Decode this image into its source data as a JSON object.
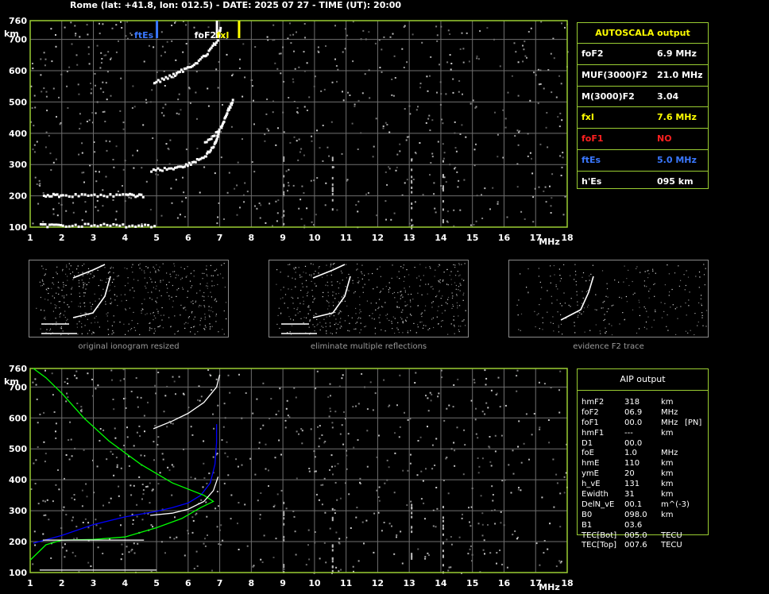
{
  "header": "Rome (lat: +41.8, lon: 012.5) - DATE: 2025 07 27 - TIME (UT): 20:00",
  "chart_data": [
    {
      "type": "scatter",
      "title": "",
      "xlabel": "MHz",
      "ylabel": "km",
      "xlim": [
        1,
        18
      ],
      "ylim": [
        100,
        760
      ],
      "x_ticks": [
        "1",
        "2",
        "3",
        "4",
        "5",
        "6",
        "7",
        "8",
        "9",
        "10",
        "11",
        "12",
        "13",
        "14",
        "15",
        "16",
        "17",
        "18"
      ],
      "y_ticks": [
        "100",
        "200",
        "300",
        "400",
        "500",
        "600",
        "700",
        "760"
      ],
      "grid": true,
      "markers": [
        {
          "label": "ftEs",
          "x": 5.0,
          "color": "#3a78ff"
        },
        {
          "label": "foF2",
          "x": 6.9,
          "color": "#ffffff"
        },
        {
          "label": "fxI",
          "x": 7.6,
          "color": "#ffff00"
        }
      ],
      "series": [
        {
          "values": [
            [
              1.3,
              108
            ],
            [
              2,
              110
            ],
            [
              3,
              110
            ],
            [
              4,
              108
            ],
            [
              5,
              108
            ]
          ]
        },
        {
          "values": [
            [
              1.4,
              205
            ],
            [
              2,
              205
            ],
            [
              3,
              206
            ],
            [
              4,
              205
            ],
            [
              4.6,
              204
            ]
          ]
        },
        {
          "values": [
            [
              4.8,
              285
            ],
            [
              5.5,
              292
            ],
            [
              6.0,
              305
            ],
            [
              6.5,
              330
            ],
            [
              6.8,
              365
            ],
            [
              6.95,
              410
            ]
          ]
        },
        {
          "values": [
            [
              6.5,
              370
            ],
            [
              7.0,
              420
            ],
            [
              7.2,
              470
            ],
            [
              7.4,
              510
            ]
          ]
        },
        {
          "values": [
            [
              4.9,
              565
            ],
            [
              5.5,
              590
            ],
            [
              6.0,
              615
            ],
            [
              6.5,
              650
            ],
            [
              6.9,
              700
            ],
            [
              7.0,
              740
            ]
          ]
        }
      ]
    },
    {
      "type": "line",
      "title": "",
      "xlabel": "MHz",
      "ylabel": "km",
      "xlim": [
        1,
        18
      ],
      "ylim": [
        100,
        760
      ],
      "x_ticks": [
        "1",
        "2",
        "3",
        "4",
        "5",
        "6",
        "7",
        "8",
        "9",
        "10",
        "11",
        "12",
        "13",
        "14",
        "15",
        "16",
        "17",
        "18"
      ],
      "y_ticks": [
        "100",
        "200",
        "300",
        "400",
        "500",
        "600",
        "700",
        "760"
      ],
      "grid": true,
      "series": [
        {
          "color": "#0000ff",
          "values": [
            [
              1.1,
              195
            ],
            [
              2,
              220
            ],
            [
              3,
              255
            ],
            [
              4,
              280
            ],
            [
              5,
              298
            ],
            [
              5.5,
              310
            ],
            [
              6,
              325
            ],
            [
              6.4,
              350
            ],
            [
              6.7,
              390
            ],
            [
              6.85,
              450
            ],
            [
              6.9,
              520
            ],
            [
              6.9,
              580
            ]
          ]
        },
        {
          "color": "#00ff00",
          "values": [
            [
              1.0,
              140
            ],
            [
              1.5,
              190
            ],
            [
              2.0,
              205
            ],
            [
              3.0,
              207
            ],
            [
              4.0,
              215
            ],
            [
              5.0,
              245
            ],
            [
              5.8,
              275
            ],
            [
              6.4,
              310
            ],
            [
              6.8,
              330
            ],
            [
              6.5,
              350
            ],
            [
              5.5,
              390
            ],
            [
              4.5,
              450
            ],
            [
              3.5,
              525
            ],
            [
              2.7,
              600
            ],
            [
              2.0,
              680
            ],
            [
              1.5,
              730
            ],
            [
              1.1,
              760
            ]
          ]
        },
        {
          "color": "#ffffff",
          "values": [
            [
              1.3,
              108
            ],
            [
              5.0,
              108
            ]
          ]
        },
        {
          "color": "#ffffff",
          "values": [
            [
              1.4,
              205
            ],
            [
              4.6,
              205
            ]
          ]
        },
        {
          "color": "#ffffff",
          "values": [
            [
              4.8,
              285
            ],
            [
              5.5,
              292
            ],
            [
              6.0,
              305
            ],
            [
              6.5,
              330
            ],
            [
              6.8,
              365
            ],
            [
              6.95,
              410
            ]
          ]
        },
        {
          "color": "#ffffff",
          "values": [
            [
              4.9,
              565
            ],
            [
              5.5,
              590
            ],
            [
              6.0,
              615
            ],
            [
              6.5,
              650
            ],
            [
              6.9,
              700
            ],
            [
              7.0,
              740
            ]
          ]
        }
      ]
    }
  ],
  "autoscala": {
    "title": "AUTOSCALA output",
    "rows": [
      {
        "label": "foF2",
        "value": "6.9 MHz",
        "color": "#ffffff"
      },
      {
        "label": "MUF(3000)F2",
        "value": "21.0 MHz",
        "color": "#ffffff"
      },
      {
        "label": "M(3000)F2",
        "value": "3.04",
        "color": "#ffffff"
      },
      {
        "label": "fxI",
        "value": "7.6 MHz",
        "color": "#ffff00"
      },
      {
        "label": "foF1",
        "value": "NO",
        "color": "#ff2020"
      },
      {
        "label": "ftEs",
        "value": "5.0 MHz",
        "color": "#3a78ff"
      },
      {
        "label": "h'Es",
        "value": "095    km",
        "color": "#ffffff"
      }
    ]
  },
  "thumbnails": [
    {
      "caption": "original ionogram resized"
    },
    {
      "caption": "eliminate multiple reflections"
    },
    {
      "caption": "evidence F2 trace"
    }
  ],
  "aip": {
    "title": "AIP output",
    "rows": [
      {
        "name": "hmF2",
        "value": "318",
        "unit": "km",
        "extra": ""
      },
      {
        "name": "foF2",
        "value": "06.9",
        "unit": "MHz",
        "extra": ""
      },
      {
        "name": "foF1",
        "value": "00.0",
        "unit": "MHz",
        "extra": "[PN]"
      },
      {
        "name": "hmF1",
        "value": "---",
        "unit": "km",
        "extra": ""
      },
      {
        "name": "D1",
        "value": "00.0",
        "unit": "",
        "extra": ""
      },
      {
        "name": "foE",
        "value": "1.0",
        "unit": "MHz",
        "extra": ""
      },
      {
        "name": "hmE",
        "value": "110",
        "unit": "km",
        "extra": ""
      },
      {
        "name": "ymE",
        "value": "20",
        "unit": "km",
        "extra": ""
      },
      {
        "name": "h_vE",
        "value": "131",
        "unit": "km",
        "extra": ""
      },
      {
        "name": "Ewidth",
        "value": "31",
        "unit": "km",
        "extra": ""
      },
      {
        "name": "DelN_vE",
        "value": "00.1",
        "unit": "m^(-3)",
        "extra": ""
      },
      {
        "name": "B0",
        "value": "098.0",
        "unit": "km",
        "extra": ""
      },
      {
        "name": "B1",
        "value": "03.6",
        "unit": "",
        "extra": ""
      },
      {
        "name": "TEC[Bot]",
        "value": "005.0",
        "unit": "TECU",
        "extra": ""
      },
      {
        "name": "TEC[Top]",
        "value": "007.6",
        "unit": "TECU",
        "extra": ""
      }
    ]
  }
}
